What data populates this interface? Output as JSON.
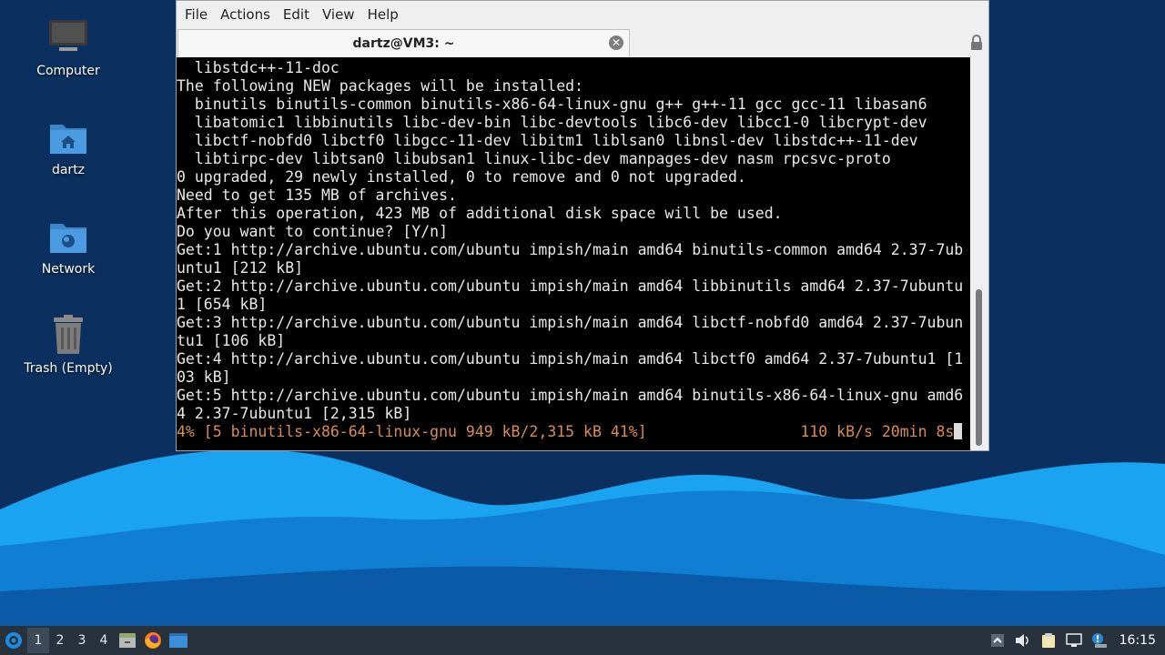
{
  "desktop": {
    "icons": [
      {
        "label": "Computer"
      },
      {
        "label": "dartz"
      },
      {
        "label": "Network"
      },
      {
        "label": "Trash (Empty)"
      }
    ]
  },
  "window": {
    "menu": [
      "File",
      "Actions",
      "Edit",
      "View",
      "Help"
    ],
    "tab_title": "dartz@VM3: ~",
    "terminal": {
      "lines": [
        "  libstdc++-11-doc",
        "The following NEW packages will be installed:",
        "  binutils binutils-common binutils-x86-64-linux-gnu g++ g++-11 gcc gcc-11 libasan6",
        "  libatomic1 libbinutils libc-dev-bin libc-devtools libc6-dev libcc1-0 libcrypt-dev",
        "  libctf-nobfd0 libctf0 libgcc-11-dev libitm1 liblsan0 libnsl-dev libstdc++-11-dev",
        "  libtirpc-dev libtsan0 libubsan1 linux-libc-dev manpages-dev nasm rpcsvc-proto",
        "0 upgraded, 29 newly installed, 0 to remove and 0 not upgraded.",
        "Need to get 135 MB of archives.",
        "After this operation, 423 MB of additional disk space will be used.",
        "Do you want to continue? [Y/n]",
        "Get:1 http://archive.ubuntu.com/ubuntu impish/main amd64 binutils-common amd64 2.37-7ub",
        "untu1 [212 kB]",
        "Get:2 http://archive.ubuntu.com/ubuntu impish/main amd64 libbinutils amd64 2.37-7ubuntu",
        "1 [654 kB]",
        "Get:3 http://archive.ubuntu.com/ubuntu impish/main amd64 libctf-nobfd0 amd64 2.37-7ubun",
        "tu1 [106 kB]",
        "Get:4 http://archive.ubuntu.com/ubuntu impish/main amd64 libctf0 amd64 2.37-7ubuntu1 [1",
        "03 kB]",
        "Get:5 http://archive.ubuntu.com/ubuntu impish/main amd64 binutils-x86-64-linux-gnu amd6",
        "4 2.37-7ubuntu1 [2,315 kB]"
      ],
      "progress_line": "4% [5 binutils-x86-64-linux-gnu 949 kB/2,315 kB 41%]                 110 kB/s 20min 8s"
    }
  },
  "taskbar": {
    "workspaces": [
      "1",
      "2",
      "3",
      "4"
    ],
    "clock": "16:15"
  },
  "colors": {
    "wallpaper_dark": "#0b2f5e",
    "wave_light": "#1ea0ef",
    "wave_mid": "#0f7ed3",
    "taskbar": "#27323d",
    "progress_text": "#d98c55"
  }
}
